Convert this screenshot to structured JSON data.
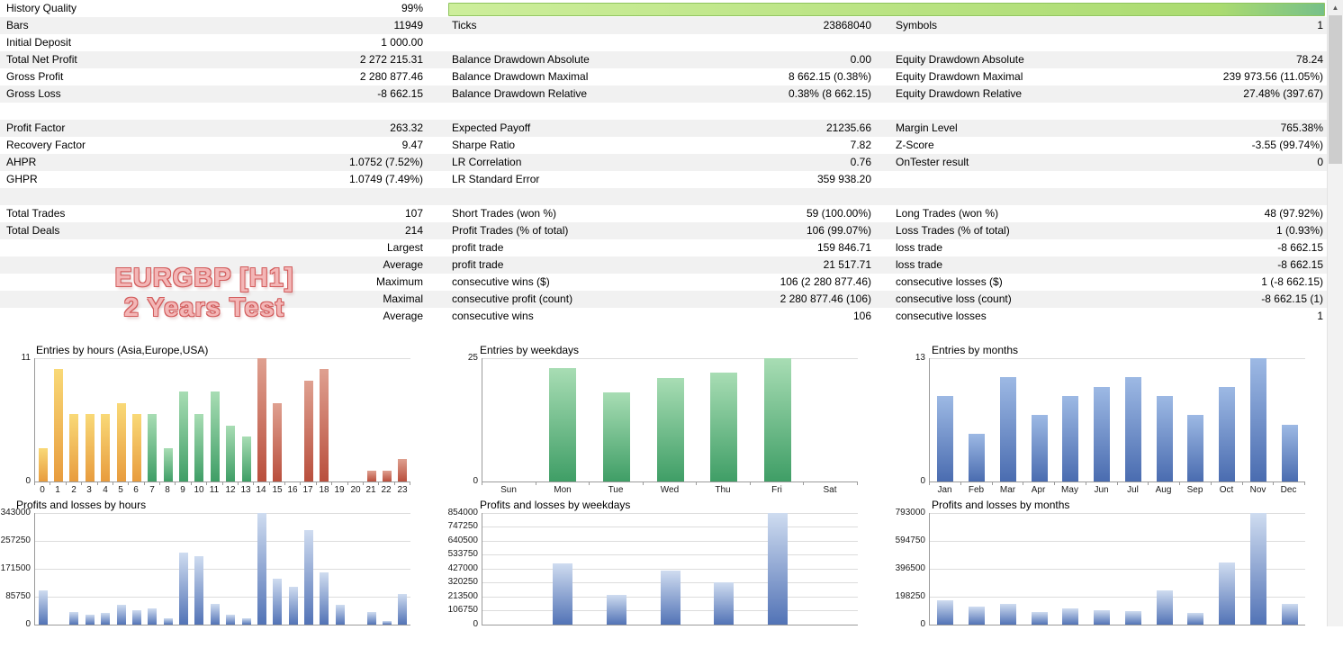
{
  "scrollbar": {
    "up_arrow": "▲"
  },
  "watermark": {
    "line1": "EURGBP [H1]",
    "line2": "2 Years Test",
    "fill_color": "#f3b6b6",
    "outline_color": "#d25c5c"
  },
  "progress": {
    "start_color": "#cdee9b",
    "mid_color": "#abdb70",
    "end_color": "#76c088"
  },
  "palettes": {
    "asia": [
      "#f9d977",
      "#e89c3e"
    ],
    "europe": [
      "#a8ddb4",
      "#3f9e66"
    ],
    "usa": [
      "#dfa090",
      "#b94f3d"
    ],
    "blue": [
      "#9db9e4",
      "#4a6cb0"
    ],
    "profit": [
      "#cfdcf0",
      "#5273b6"
    ]
  },
  "stats_rows": [
    {
      "c1l": "History Quality",
      "c1v": "99%",
      "progress": true
    },
    {
      "c1l": "Bars",
      "c1v": "11949",
      "c2l": "Ticks",
      "c2v": "23868040",
      "c3l": "Symbols",
      "c3v": "1"
    },
    {
      "c1l": "Initial Deposit",
      "c1v": "1 000.00"
    },
    {
      "c1l": "Total Net Profit",
      "c1v": "2 272 215.31",
      "c2l": "Balance Drawdown Absolute",
      "c2v": "0.00",
      "c3l": "Equity Drawdown Absolute",
      "c3v": "78.24"
    },
    {
      "c1l": "Gross Profit",
      "c1v": "2 280 877.46",
      "c2l": "Balance Drawdown Maximal",
      "c2v": "8 662.15 (0.38%)",
      "c3l": "Equity Drawdown Maximal",
      "c3v": "239 973.56 (11.05%)"
    },
    {
      "c1l": "Gross Loss",
      "c1v": "-8 662.15",
      "c2l": "Balance Drawdown Relative",
      "c2v": "0.38% (8 662.15)",
      "c3l": "Equity Drawdown Relative",
      "c3v": "27.48% (397.67)"
    },
    {},
    {
      "c1l": "Profit Factor",
      "c1v": "263.32",
      "c2l": "Expected Payoff",
      "c2v": "21235.66",
      "c3l": "Margin Level",
      "c3v": "765.38%"
    },
    {
      "c1l": "Recovery Factor",
      "c1v": "9.47",
      "c2l": "Sharpe Ratio",
      "c2v": "7.82",
      "c3l": "Z-Score",
      "c3v": "-3.55 (99.74%)"
    },
    {
      "c1l": "AHPR",
      "c1v": "1.0752 (7.52%)",
      "c2l": "LR Correlation",
      "c2v": "0.76",
      "c3l": "OnTester result",
      "c3v": "0"
    },
    {
      "c1l": "GHPR",
      "c1v": "1.0749 (7.49%)",
      "c2l": "LR Standard Error",
      "c2v": "359 938.20"
    },
    {},
    {
      "c1l": "Total Trades",
      "c1v": "107",
      "c2l": "Short Trades (won %)",
      "c2v": "59 (100.00%)",
      "c3l": "Long Trades (won %)",
      "c3v": "48 (97.92%)"
    },
    {
      "c1l": "Total Deals",
      "c1v": "214",
      "c2l": "Profit Trades (% of total)",
      "c2v": "106 (99.07%)",
      "c3l": "Loss Trades (% of total)",
      "c3v": "1 (0.93%)"
    },
    {
      "c1v": "Largest",
      "c2l": "profit trade",
      "c2v": "159 846.71",
      "c3l": "loss trade",
      "c3v": "-8 662.15"
    },
    {
      "c1v": "Average",
      "c2l": "profit trade",
      "c2v": "21 517.71",
      "c3l": "loss trade",
      "c3v": "-8 662.15"
    },
    {
      "c1v": "Maximum",
      "c2l": "consecutive wins ($)",
      "c2v": "106 (2 280 877.46)",
      "c3l": "consecutive losses ($)",
      "c3v": "1 (-8 662.15)"
    },
    {
      "c1v": "Maximal",
      "c2l": "consecutive profit (count)",
      "c2v": "2 280 877.46 (106)",
      "c3l": "consecutive loss (count)",
      "c3v": "-8 662.15 (1)"
    },
    {
      "c1v": "Average",
      "c2l": "consecutive wins",
      "c2v": "106",
      "c3l": "consecutive losses",
      "c3v": "1"
    }
  ],
  "chart_data": [
    {
      "id": "entries-by-hours",
      "type": "bar",
      "title": "Entries by hours (Asia,Europe,USA)",
      "categories": [
        "0",
        "1",
        "2",
        "3",
        "4",
        "5",
        "6",
        "7",
        "8",
        "9",
        "10",
        "11",
        "12",
        "13",
        "14",
        "15",
        "16",
        "17",
        "18",
        "19",
        "20",
        "21",
        "22",
        "23"
      ],
      "values": [
        3,
        10,
        6,
        6,
        6,
        7,
        6,
        6,
        3,
        8,
        6,
        8,
        5,
        4,
        11,
        7,
        0,
        9,
        10,
        0,
        0,
        1,
        1,
        2
      ],
      "bar_palettes": [
        "asia",
        "asia",
        "asia",
        "asia",
        "asia",
        "asia",
        "asia",
        "europe",
        "europe",
        "europe",
        "europe",
        "europe",
        "europe",
        "europe",
        "usa",
        "usa",
        "usa",
        "usa",
        "usa",
        "usa",
        "usa",
        "usa",
        "usa",
        "usa"
      ],
      "ylim": [
        0,
        11
      ],
      "yticks": [
        0,
        11
      ],
      "xlabel": "",
      "ylabel": "",
      "legend": "none",
      "grid": "top-and-baseline"
    },
    {
      "id": "entries-by-weekdays",
      "type": "bar",
      "title": "Entries by weekdays",
      "categories": [
        "Sun",
        "Mon",
        "Tue",
        "Wed",
        "Thu",
        "Fri",
        "Sat"
      ],
      "values": [
        0,
        23,
        18,
        21,
        22,
        25,
        0
      ],
      "palette": "europe",
      "ylim": [
        0,
        25
      ],
      "yticks": [
        0,
        25
      ],
      "xlabel": "",
      "ylabel": "",
      "legend": "none",
      "grid": "top-and-baseline"
    },
    {
      "id": "entries-by-months",
      "type": "bar",
      "title": "Entries by months",
      "categories": [
        "Jan",
        "Feb",
        "Mar",
        "Apr",
        "May",
        "Jun",
        "Jul",
        "Aug",
        "Sep",
        "Oct",
        "Nov",
        "Dec"
      ],
      "values": [
        9,
        5,
        11,
        7,
        9,
        10,
        11,
        9,
        7,
        10,
        13,
        6
      ],
      "palette": "blue",
      "ylim": [
        0,
        13
      ],
      "yticks": [
        0,
        13
      ],
      "xlabel": "",
      "ylabel": "",
      "legend": "none",
      "grid": "top-and-baseline"
    },
    {
      "id": "pl-by-hours",
      "type": "bar",
      "title": "Profits and losses by hours",
      "categories": [
        "0",
        "1",
        "2",
        "3",
        "4",
        "5",
        "6",
        "7",
        "8",
        "9",
        "10",
        "11",
        "12",
        "13",
        "14",
        "15",
        "16",
        "17",
        "18",
        "19",
        "20",
        "21",
        "22",
        "23"
      ],
      "values": [
        105000,
        0,
        40000,
        30000,
        35000,
        60000,
        45000,
        50000,
        20000,
        220000,
        210000,
        65000,
        30000,
        20000,
        343000,
        140000,
        115000,
        290000,
        160000,
        60000,
        0,
        40000,
        10000,
        95000
      ],
      "palette": "profit",
      "ylim": [
        0,
        343000
      ],
      "yticks": [
        0,
        85750,
        171500,
        257250,
        343000
      ],
      "xlabel": "",
      "ylabel": "",
      "legend": "none",
      "grid": "horizontal"
    },
    {
      "id": "pl-by-weekdays",
      "type": "bar",
      "title": "Profits and losses by weekdays",
      "categories": [
        "Sun",
        "Mon",
        "Tue",
        "Wed",
        "Thu",
        "Fri",
        "Sat"
      ],
      "values": [
        0,
        470000,
        230000,
        410000,
        325000,
        854000,
        0
      ],
      "palette": "profit",
      "ylim": [
        0,
        854000
      ],
      "yticks": [
        0,
        106750,
        213500,
        320250,
        427000,
        533750,
        640500,
        747250,
        854000
      ],
      "xlabel": "",
      "ylabel": "",
      "legend": "none",
      "grid": "horizontal"
    },
    {
      "id": "pl-by-months",
      "type": "bar",
      "title": "Profits and losses by months",
      "categories": [
        "Jan",
        "Feb",
        "Mar",
        "Apr",
        "May",
        "Jun",
        "Jul",
        "Aug",
        "Sep",
        "Oct",
        "Nov",
        "Dec"
      ],
      "values": [
        170000,
        130000,
        150000,
        90000,
        115000,
        100000,
        95000,
        240000,
        85000,
        440000,
        793000,
        145000
      ],
      "palette": "profit",
      "ylim": [
        0,
        793000
      ],
      "yticks": [
        0,
        198250,
        396500,
        594750,
        793000
      ],
      "xlabel": "",
      "ylabel": "",
      "legend": "none",
      "grid": "horizontal"
    }
  ]
}
